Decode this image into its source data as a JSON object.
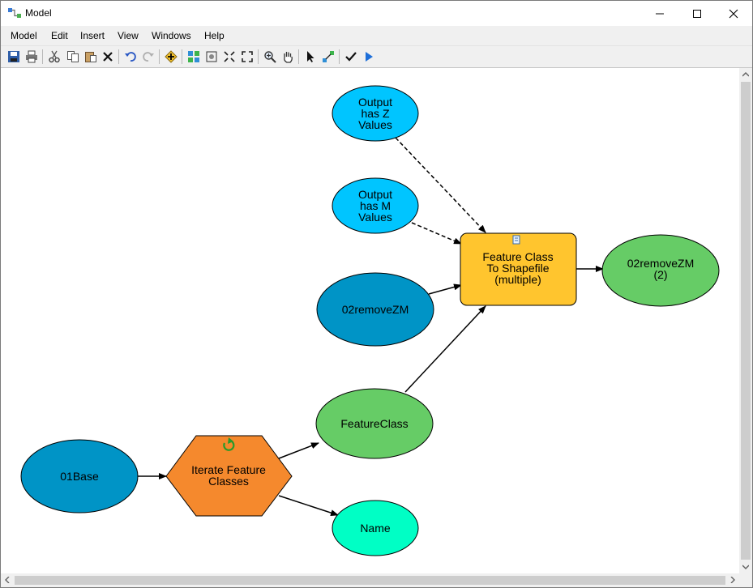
{
  "window": {
    "title": "Model"
  },
  "menu": [
    "Model",
    "Edit",
    "Insert",
    "View",
    "Windows",
    "Help"
  ],
  "toolbar_icons": [
    "save-icon",
    "print-icon",
    "cut-icon",
    "copy-icon",
    "paste-icon",
    "delete-icon",
    "undo-icon",
    "redo-icon",
    "add-data-icon",
    "auto-layout-icon",
    "full-extent-icon",
    "fixed-zoom-in-icon",
    "fixed-zoom-out-icon",
    "zoom-in-icon",
    "pan-icon",
    "select-icon",
    "connect-icon",
    "validate-icon",
    "run-icon"
  ],
  "model": {
    "nodes": {
      "output_z": [
        "Output",
        "has Z",
        "Values"
      ],
      "output_m": [
        "Output",
        "has M",
        "Values"
      ],
      "remove_zm": [
        "02removeZM"
      ],
      "fc_to_shp": [
        "Feature Class",
        "To Shapefile",
        "(multiple)"
      ],
      "remove_zm_2": [
        "02removeZM",
        "(2)"
      ],
      "feature_class": [
        "FeatureClass"
      ],
      "base": [
        "01Base"
      ],
      "iterate": [
        "Iterate Feature",
        "Classes"
      ],
      "name": [
        "Name"
      ]
    },
    "colors": {
      "precondition_blue": "#00c5ff",
      "input_blue": "#0094c6",
      "tool_yellow": "#ffc52e",
      "output_green": "#66cc66",
      "iterator_orange": "#f5892d",
      "name_teal": "#00ffc5"
    }
  }
}
